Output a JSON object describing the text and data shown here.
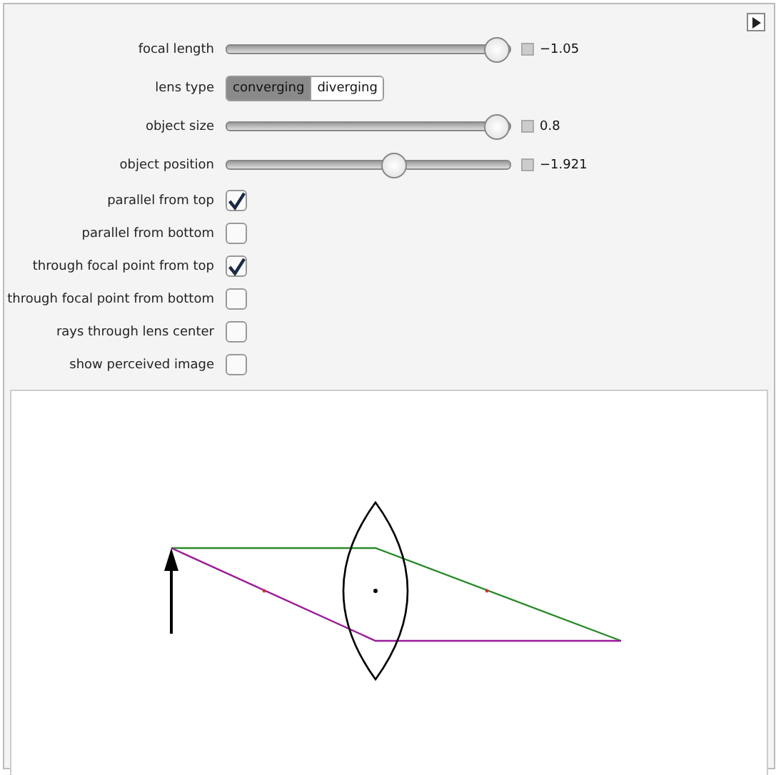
{
  "controls": [
    {
      "kind": "slider",
      "label": "focal length",
      "level": 0.95,
      "reading": "−1.05"
    },
    {
      "kind": "toggle",
      "label": "lens type",
      "options": [
        {
          "label": "converging",
          "selected": true
        },
        {
          "label": "diverging",
          "selected": false
        }
      ]
    },
    {
      "kind": "slider",
      "label": "object size",
      "level": 0.95,
      "reading": "0.8"
    },
    {
      "kind": "slider",
      "label": "object position",
      "level": 0.59,
      "reading": "−1.921"
    },
    {
      "kind": "checkbox",
      "label": "parallel from top",
      "checked": true
    },
    {
      "kind": "checkbox",
      "label": "parallel from bottom",
      "checked": false
    },
    {
      "kind": "checkbox",
      "label": "through focal point from top",
      "checked": true
    },
    {
      "kind": "checkbox",
      "label": "through focal point from bottom",
      "checked": false
    },
    {
      "kind": "checkbox",
      "label": "rays through lens center",
      "checked": false
    },
    {
      "kind": "checkbox",
      "label": "show perceived image",
      "checked": false
    }
  ]
}
